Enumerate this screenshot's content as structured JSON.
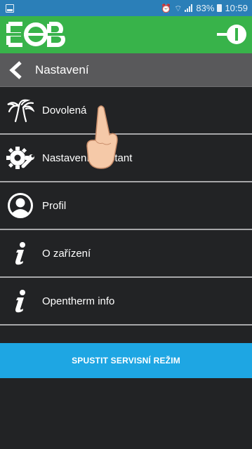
{
  "statusbar": {
    "left_icon": "sim-icon",
    "alarm_icon": "alarm-icon",
    "wifi_icon": "wifi-icon",
    "signal_icon": "signal-icon",
    "battery_percent": "83%",
    "battery_icon": "battery-icon",
    "time": "10:59"
  },
  "appbar": {
    "logo_icon": "eob-logo",
    "power_icon": "power-plug-icon",
    "color": "#38b34a"
  },
  "navbar": {
    "back_icon": "chevron-left-icon",
    "title": "Nastavení"
  },
  "menu": {
    "items": [
      {
        "label": "Dovolená",
        "icon": "palm-tree-icon"
      },
      {
        "label": "Nastavení konstant",
        "icon": "gear-wrench-icon"
      },
      {
        "label": "Profil",
        "icon": "user-circle-icon"
      },
      {
        "label": "O zařízení",
        "icon": "info-icon"
      },
      {
        "label": "Opentherm info",
        "icon": "info-icon"
      }
    ]
  },
  "service_button": {
    "label": "SPUSTIT SERVISNÍ REŽIM",
    "color": "#1ea6e3"
  },
  "overlay": {
    "icon": "pointing-hand-icon"
  }
}
